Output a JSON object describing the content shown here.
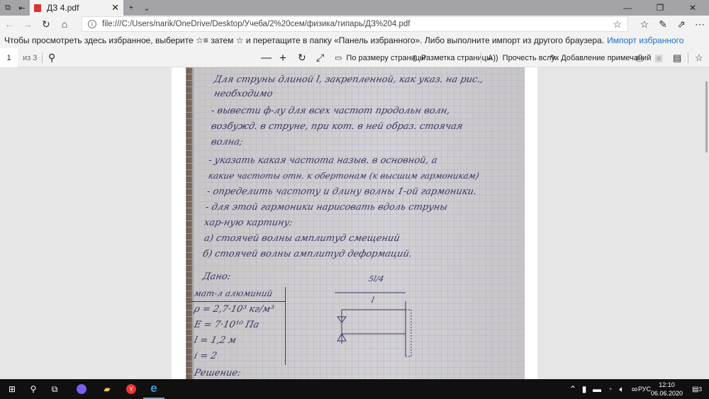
{
  "tab": {
    "title": "ДЗ 4.pdf"
  },
  "address": {
    "url": "file:///C:/Users/narik/OneDrive/Desktop/Учеба/2%20сем/физика/типарь/ДЗ%204.pdf"
  },
  "favbar": {
    "text": "Чтобы просмотреть здесь избранное, выберите ☆≡ затем ☆ и перетащите в папку «Панель избранного». Либо выполните импорт из другого браузера.",
    "link": "Импорт избранного"
  },
  "pdf_toolbar": {
    "page": "1",
    "of": "из 3",
    "fit": "По размеру страницы",
    "layout": "Разметка страницы",
    "read": "Прочесть вслух",
    "annotate": "Добавление примечаний"
  },
  "document_lines": [
    "Для струны длиной l, закрепленной, как указ. на рис.,",
    "необходимо",
    "- вывести ф-лу для всех частот продольн волн,",
    "возбужд. в струне, при кот. в ней образ. стоячая",
    "волна;",
    "- указать какая частота назыв. в основной, а",
    "какие частоты отн. к обертонам (к высшим гармоникам)",
    "- определить частоту и длину волны 1-ой гармоники.",
    "- для этой гармоники нарисовать вдоль струны",
    "хар-ную картину:",
    "а) стоячей волны амплитуд смещений",
    "б) стоячей волны амплитуд деформаций.",
    "Дано:",
    "мат-л алюминий",
    "ρ = 2,7·10³ кг/м³",
    "E = 7·10¹⁰ Па",
    "l = 1,2 м",
    "i = 2",
    "Решение:"
  ],
  "diagram": {
    "top": "5l/4",
    "bottom": "l"
  },
  "taskbar": {
    "lang": "РУС",
    "time": "12:10",
    "date": "06.06.2020",
    "notifications": "3"
  }
}
